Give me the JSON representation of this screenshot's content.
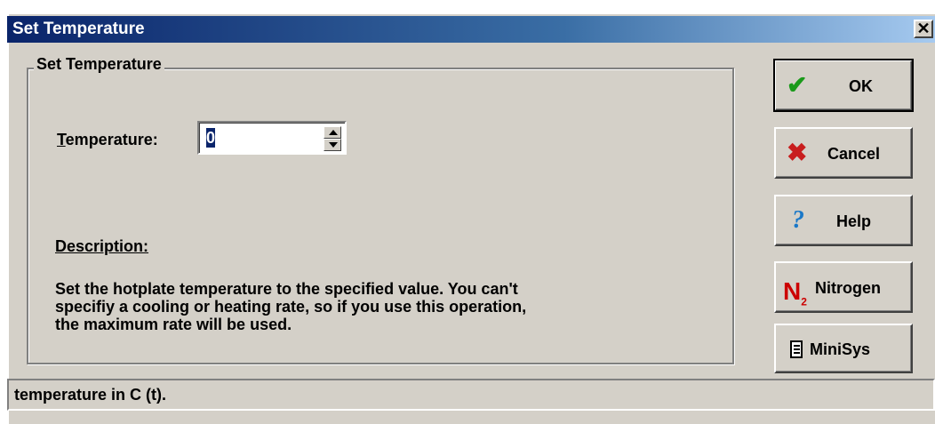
{
  "window": {
    "title": "Set Temperature",
    "close_symbol": "✕"
  },
  "group": {
    "legend": "Set Temperature"
  },
  "temperature": {
    "label_accel": "T",
    "label_rest": "emperature:",
    "value": "0"
  },
  "description": {
    "heading": "Description:",
    "text": "Set the hotplate temperature to the specified value. You can't\nspecifiy a cooling or heating rate, so if you use this operation,\nthe maximum rate will be used."
  },
  "buttons": {
    "ok": {
      "label": "OK",
      "icon": "checkmark-icon",
      "glyph": "✔"
    },
    "cancel": {
      "label": "Cancel",
      "icon": "x-icon",
      "glyph": "✖"
    },
    "help": {
      "label": "Help",
      "icon": "question-icon",
      "glyph": "?"
    },
    "nitrogen": {
      "label": "Nitrogen",
      "icon": "n2-icon",
      "glyph_main": "N",
      "glyph_sub": "2"
    },
    "minisys": {
      "label": "MiniSys",
      "icon": "document-icon"
    }
  },
  "status": {
    "text": "temperature in C (t)."
  },
  "colors": {
    "titlebar_start": "#0a246a",
    "titlebar_end": "#a6caf0",
    "face": "#d4d0c8",
    "ok_icon": "#1a9a1a",
    "cancel_icon": "#c81e1e",
    "help_icon": "#1a78c8",
    "n2_icon": "#cc0000"
  }
}
